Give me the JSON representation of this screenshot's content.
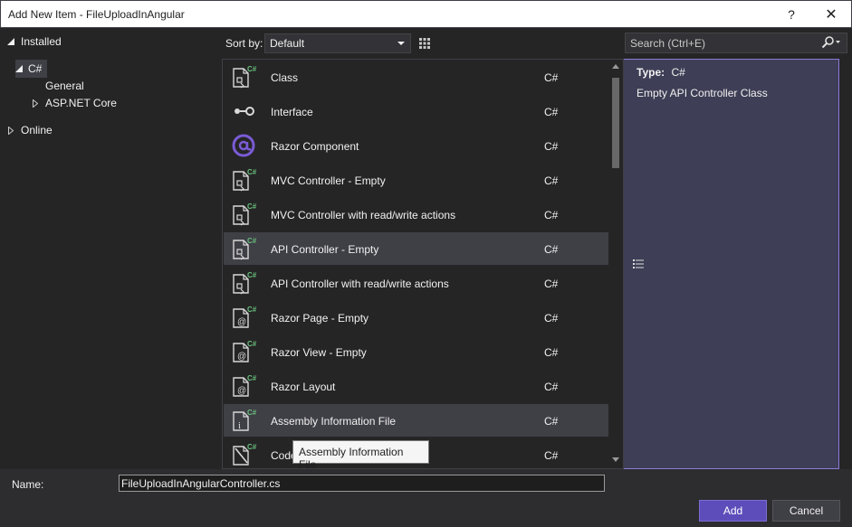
{
  "window": {
    "title": "Add New Item - FileUploadInAngular",
    "help_label": "?",
    "close_label": "✕"
  },
  "tree": {
    "installed": "Installed",
    "csharp": "C#",
    "general": "General",
    "aspnetcore": "ASP.NET Core",
    "online": "Online"
  },
  "toolbar": {
    "sort_label": "Sort by:",
    "sort_value": "Default",
    "search_placeholder": "Search (Ctrl+E)"
  },
  "items": [
    {
      "name": "Class",
      "lang": "C#",
      "icon": "class-icon"
    },
    {
      "name": "Interface",
      "lang": "C#",
      "icon": "interface-icon"
    },
    {
      "name": "Razor Component",
      "lang": "C#",
      "icon": "razor-component-icon"
    },
    {
      "name": "MVC Controller - Empty",
      "lang": "C#",
      "icon": "controller-icon"
    },
    {
      "name": "MVC Controller with read/write actions",
      "lang": "C#",
      "icon": "controller-icon"
    },
    {
      "name": "API Controller - Empty",
      "lang": "C#",
      "icon": "controller-icon"
    },
    {
      "name": "API Controller with read/write actions",
      "lang": "C#",
      "icon": "controller-icon"
    },
    {
      "name": "Razor Page - Empty",
      "lang": "C#",
      "icon": "razor-page-icon"
    },
    {
      "name": "Razor View - Empty",
      "lang": "C#",
      "icon": "razor-view-icon"
    },
    {
      "name": "Razor Layout",
      "lang": "C#",
      "icon": "razor-layout-icon"
    },
    {
      "name": "Assembly Information File",
      "lang": "C#",
      "icon": "assembly-info-icon"
    },
    {
      "name": "Code",
      "lang": "C#",
      "icon": "code-analysis-icon"
    }
  ],
  "tooltip": "Assembly Information File",
  "details": {
    "type_label": "Type:",
    "type_value": "C#",
    "description": "Empty API Controller Class"
  },
  "bottom": {
    "name_label": "Name:",
    "name_value": "FileUploadInAngularController.cs",
    "add_label": "Add",
    "cancel_label": "Cancel"
  },
  "colors": {
    "accent": "#5d4dbb",
    "background": "#252526",
    "selected_row": "#3f3f46",
    "csharp_badge": "#68c07a"
  }
}
